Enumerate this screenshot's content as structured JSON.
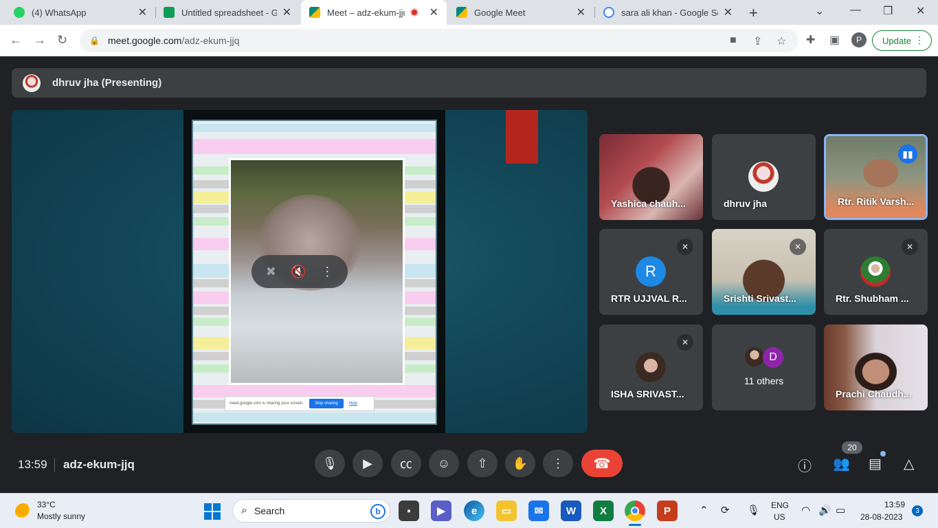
{
  "browser": {
    "tabs": [
      {
        "title": "(4) WhatsApp",
        "favicon_color": "#25d366",
        "active": false
      },
      {
        "title": "Untitled spreadsheet - Go",
        "favicon_color": "#0f9d58",
        "active": false
      },
      {
        "title": "Meet – adz-ekum-jjq",
        "favicon_color": "#00897b",
        "active": true
      },
      {
        "title": "Google Meet",
        "favicon_color": "#00897b",
        "active": false
      },
      {
        "title": "sara ali khan - Google Sea",
        "favicon_color": "#4285f4",
        "active": false
      }
    ],
    "url_host": "meet.google.com",
    "url_path": "/adz-ekum-jjq",
    "profile_initial": "P",
    "update_label": "Update"
  },
  "meet": {
    "presenter_label": "dhruv jha (Presenting)",
    "share_notice": {
      "text": "meet.google.com is sharing your screen.",
      "stop_label": "Stop sharing",
      "hide_label": "Hide"
    },
    "participants": [
      {
        "name": "Yashica chauh...",
        "kind": "video",
        "muted": false,
        "speaking": false
      },
      {
        "name": "dhruv jha",
        "kind": "avatar-image",
        "muted": false,
        "speaking": false
      },
      {
        "name": "Rtr. Ritik Varsh...",
        "kind": "video",
        "muted": false,
        "speaking": true
      },
      {
        "name": "RTR UJJVAL R...",
        "kind": "avatar-letter",
        "initial": "R",
        "avatar_color": "#1e88e5",
        "muted": true,
        "speaking": false
      },
      {
        "name": "Srishti Srivast...",
        "kind": "video",
        "muted": true,
        "speaking": false
      },
      {
        "name": "Rtr. Shubham ...",
        "kind": "avatar-image",
        "muted": true,
        "speaking": false
      },
      {
        "name": "ISHA SRIVAST...",
        "kind": "avatar-image",
        "muted": true,
        "speaking": false
      },
      {
        "name": "Prachi Chaudh...",
        "kind": "video",
        "muted": false,
        "speaking": false
      }
    ],
    "others": {
      "label": "11 others",
      "initial": "D"
    },
    "time": "13:59",
    "meeting_code": "adz-ekum-jjq",
    "participant_count": "20"
  },
  "taskbar": {
    "temperature": "33°C",
    "weather": "Mostly sunny",
    "search_placeholder": "Search",
    "lang_line1": "ENG",
    "lang_line2": "US",
    "time": "13:59",
    "date": "28-08-2023",
    "notification_count": "3"
  }
}
